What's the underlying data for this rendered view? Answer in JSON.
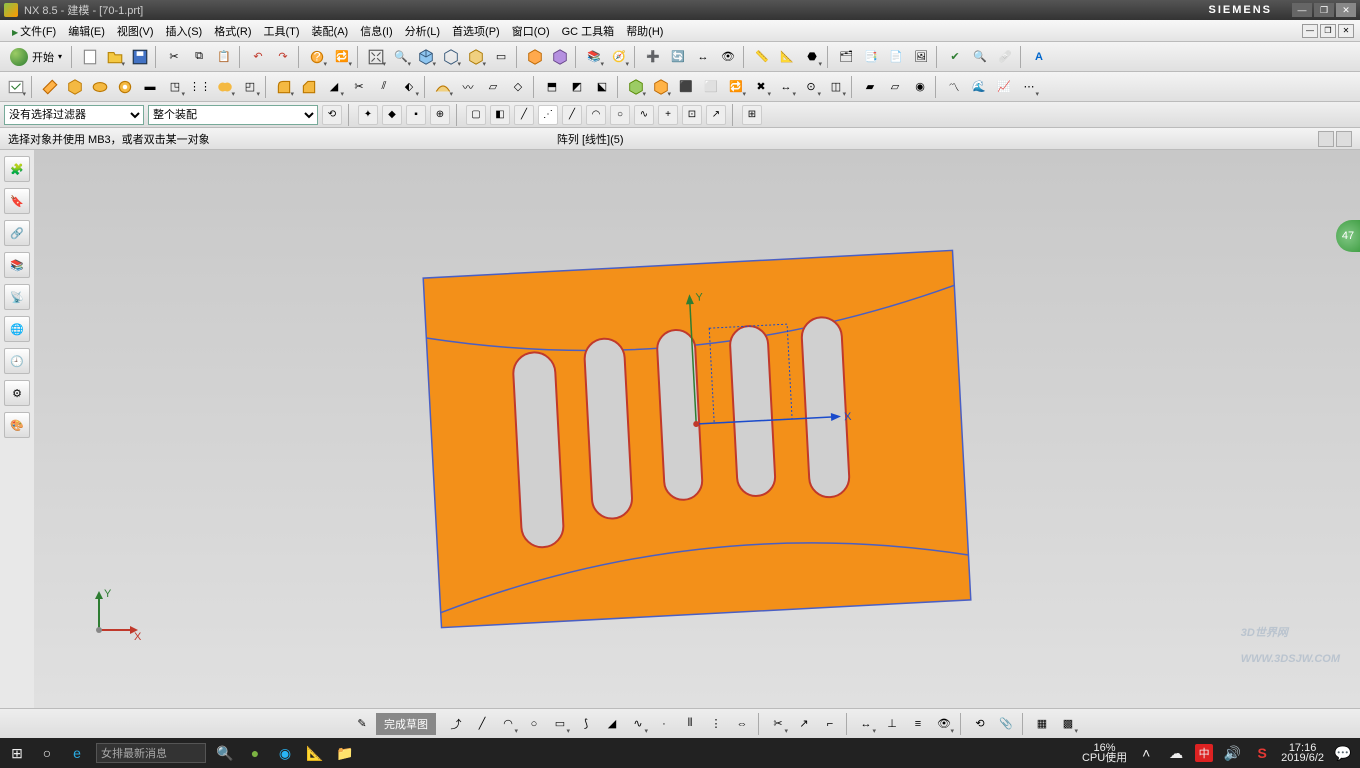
{
  "title": "NX 8.5 - 建模 - [70-1.prt]",
  "brand": "SIEMENS",
  "menu": [
    "文件(F)",
    "编辑(E)",
    "视图(V)",
    "插入(S)",
    "格式(R)",
    "工具(T)",
    "装配(A)",
    "信息(I)",
    "分析(L)",
    "首选项(P)",
    "窗口(O)",
    "GC 工具箱",
    "帮助(H)"
  ],
  "start_label": "开始",
  "filter1": "没有选择过滤器",
  "filter2": "整个装配",
  "status_left": "选择对象并使用 MB3，或者双击某一对象",
  "status_right": "阵列 [线性](5)",
  "sketch_finish": "完成草图",
  "badge": "47",
  "taskbar_search": "女排最新消息",
  "cpu_pct": "16%",
  "cpu_label": "CPU使用",
  "ime": "中",
  "time": "17:16",
  "date": "2019/6/2",
  "watermark_main": "3D世界网",
  "watermark_sub": "WWW.3DSJW.COM",
  "triad": {
    "x": "X",
    "y": "Y"
  },
  "chart_data": {
    "type": "cad_viewport",
    "object": "rectangular_plate_with_slots",
    "slot_count": 5,
    "axes_visible": [
      "X",
      "Y"
    ],
    "color": "#f39019"
  }
}
